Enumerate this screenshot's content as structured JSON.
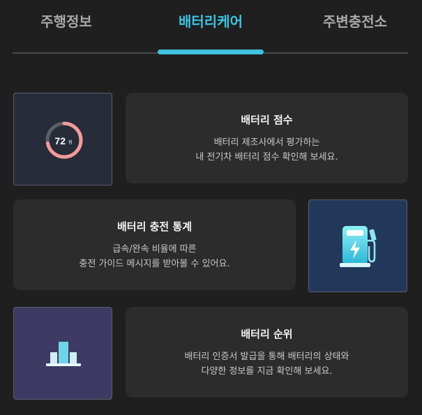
{
  "tabs": [
    {
      "label": "주행정보"
    },
    {
      "label": "배터리케어"
    },
    {
      "label": "주변충전소"
    }
  ],
  "colors": {
    "accent": "#3ec3e0",
    "background": "#1f1f1f",
    "card": "#2c2c2c"
  },
  "cards": {
    "score": {
      "title": "배터리 점수",
      "desc_line1": "배터리 제조사에서 평가하는",
      "desc_line2": "내 전기차 배터리 점수 확인해 보세요.",
      "score_value": "72",
      "score_unit": "점",
      "gauge_fraction": 0.72,
      "icon": "battery-score-gauge-icon"
    },
    "charge_stats": {
      "title": "배터리 충전 통계",
      "desc_line1": "급속/완속 비율에 따른",
      "desc_line2": "충전 가이드 메시지를 받아볼 수 있어요.",
      "icon": "ev-charger-icon"
    },
    "ranking": {
      "title": "배터리 순위",
      "desc_line1": "배터리 인증서 발급을 통해 배터리의 상태와",
      "desc_line2": "다양한 정보를 지금 확인해 보세요.",
      "icon": "podium-bar-chart-icon"
    }
  }
}
